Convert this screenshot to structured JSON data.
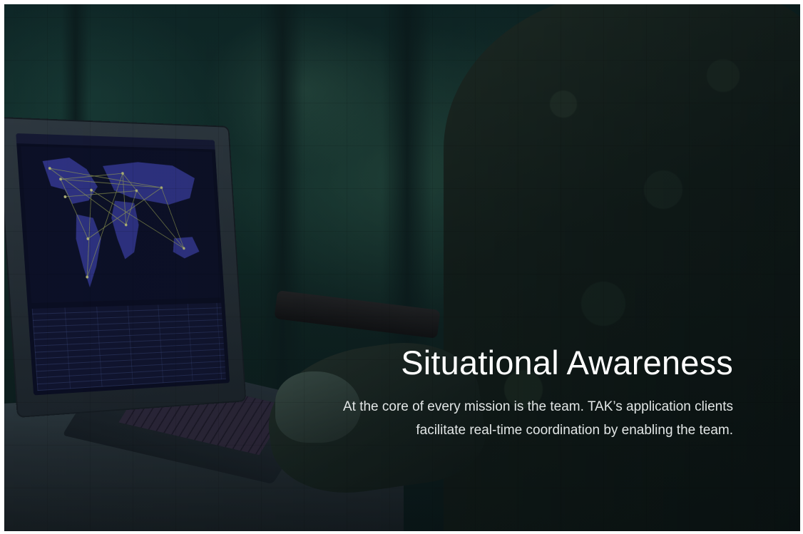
{
  "hero": {
    "headline": "Situational Awareness",
    "subtitle_line1": "At the core of every mission is the team. TAK’s application clients",
    "subtitle_line2": "facilitate real-time coordination by enabling the team."
  },
  "colors": {
    "text": "#ffffff",
    "subtitle": "#e2e6e6",
    "map_land": "#3c3fa8",
    "network_lines": "#c9d36a"
  }
}
